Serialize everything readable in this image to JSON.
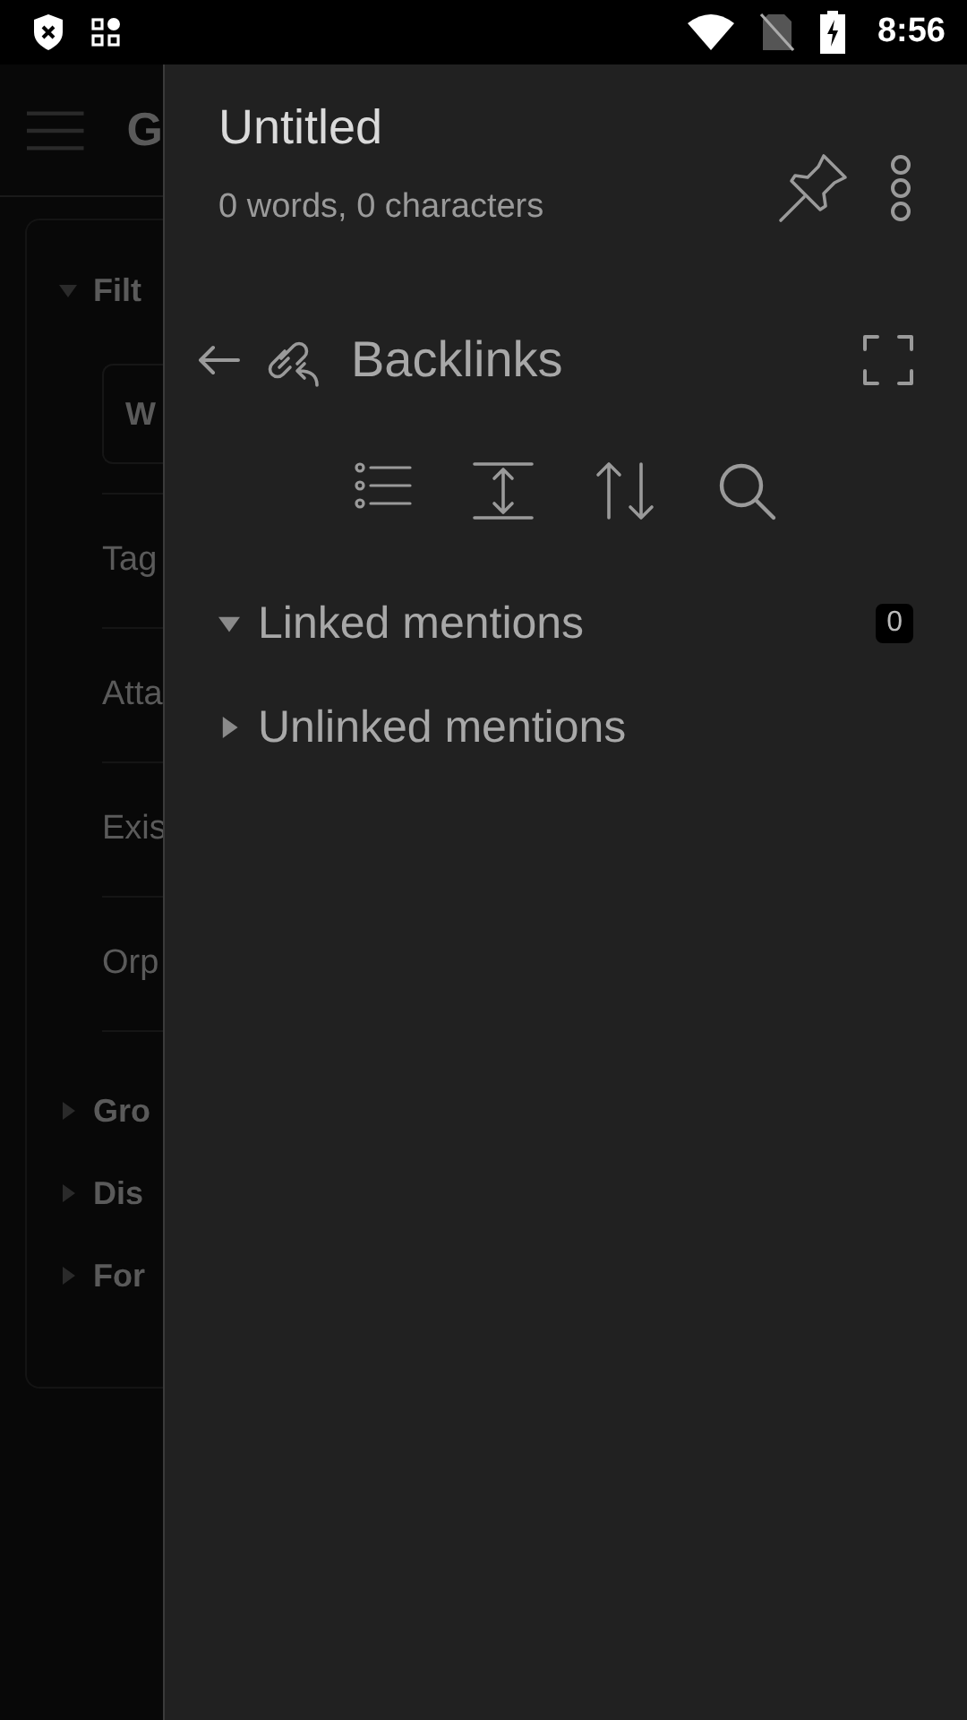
{
  "status_bar": {
    "time": "8:56"
  },
  "background_page": {
    "title": "G",
    "filter_section": {
      "label": "Filt",
      "expanded": true
    },
    "search": {
      "value": "W"
    },
    "filters": [
      "Tag",
      "Atta",
      "Exis",
      "Orp"
    ],
    "sections": [
      {
        "label": "Gro",
        "expanded": false
      },
      {
        "label": "Dis",
        "expanded": false
      },
      {
        "label": "For",
        "expanded": false
      }
    ]
  },
  "note": {
    "title": "Untitled",
    "stats": "0 words, 0 characters"
  },
  "backlinks": {
    "title": "Backlinks",
    "sections": [
      {
        "label": "Linked mentions",
        "expanded": true,
        "count": "0"
      },
      {
        "label": "Unlinked mentions",
        "expanded": false
      }
    ]
  }
}
